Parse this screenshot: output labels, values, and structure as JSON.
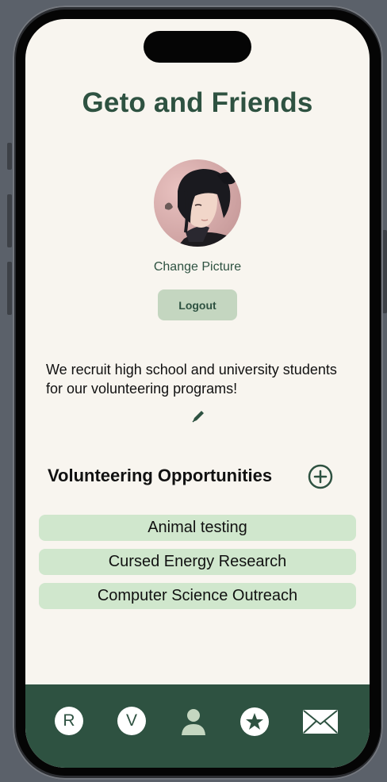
{
  "colors": {
    "brand_green": "#2e5241",
    "background": "#f8f5ef",
    "button_bg": "#c4d6c0",
    "opportunity_bg": "#d0e7cd",
    "active_tab_icon": "#c4d6c0"
  },
  "header": {
    "title": "Geto and Friends"
  },
  "profile": {
    "change_picture_label": "Change Picture",
    "logout_label": "Logout",
    "bio": "We recruit high school and university students for our volunteering programs!",
    "edit_icon": "pencil-icon"
  },
  "opportunities": {
    "title": "Volunteering Opportunities",
    "add_icon": "plus-circle-icon",
    "items": [
      {
        "label": "Animal testing"
      },
      {
        "label": "Cursed Energy Research"
      },
      {
        "label": "Computer Science Outreach"
      }
    ]
  },
  "tabbar": {
    "tabs": [
      {
        "letter": "R",
        "icon": "r-circle-icon"
      },
      {
        "letter": "V",
        "icon": "v-circle-icon"
      },
      {
        "icon": "person-icon",
        "active": true
      },
      {
        "icon": "star-circle-icon"
      },
      {
        "icon": "envelope-icon"
      }
    ]
  }
}
